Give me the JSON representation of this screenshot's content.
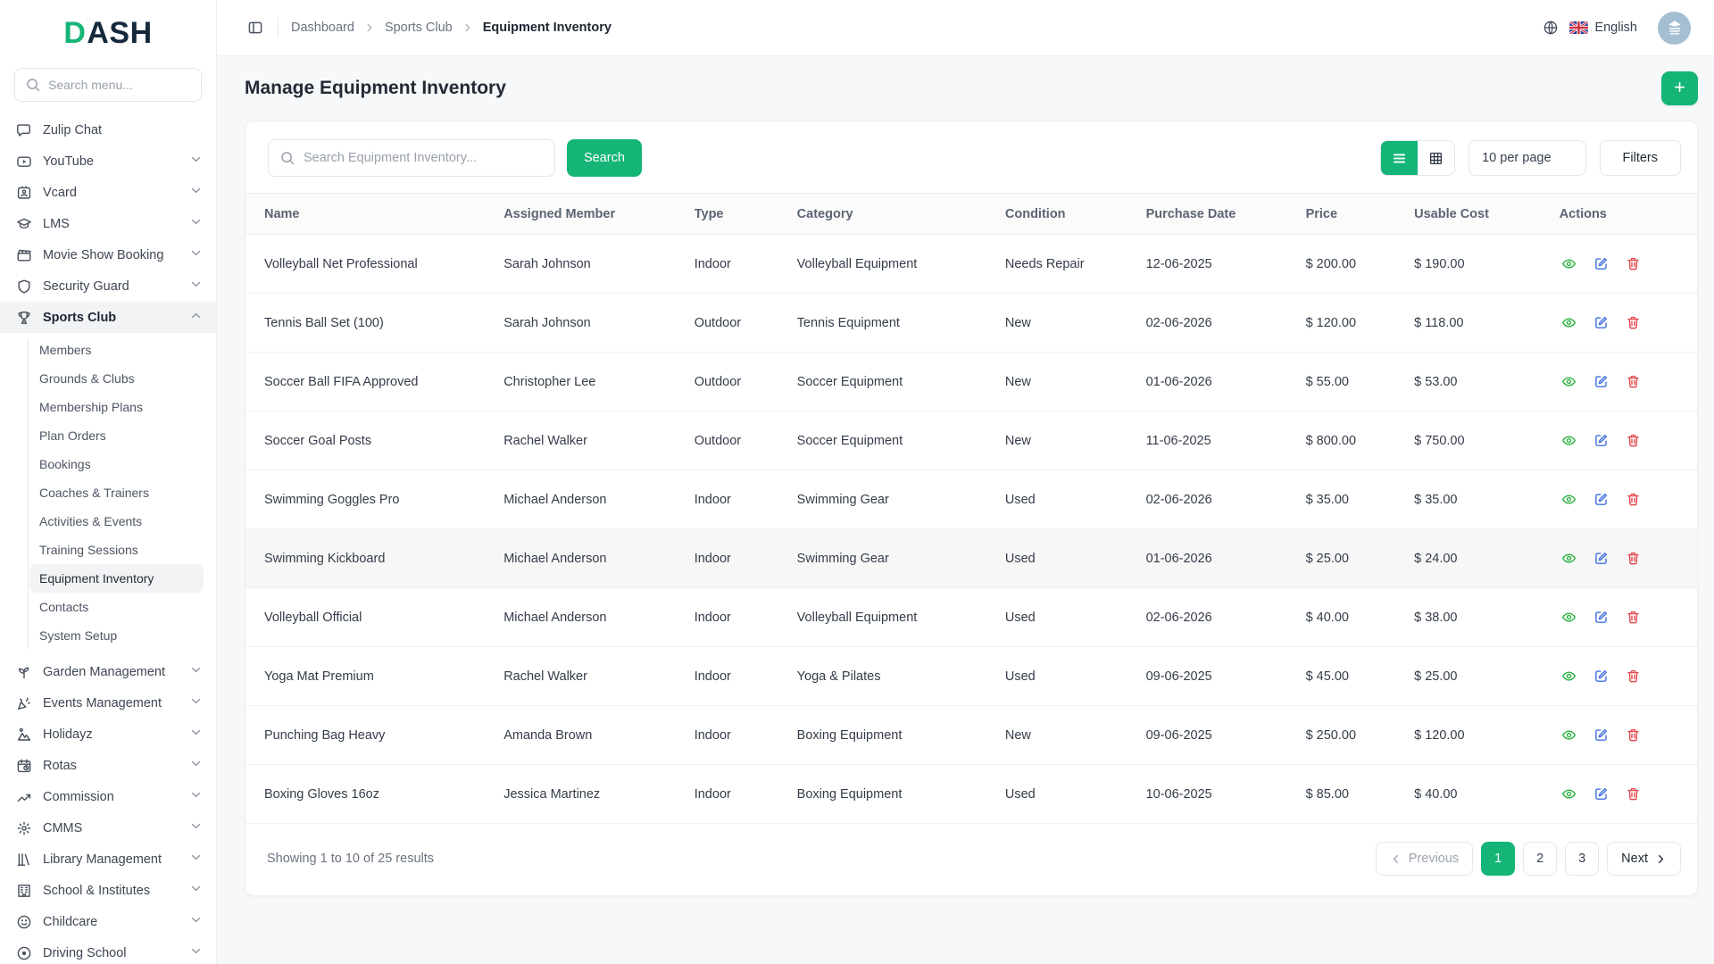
{
  "brand": {
    "logo_accent": "D",
    "logo_rest": "ASH"
  },
  "sidebar": {
    "search_placeholder": "Search menu...",
    "items": [
      {
        "label": "Zulip Chat",
        "icon": "chat-icon"
      },
      {
        "label": "YouTube",
        "icon": "youtube-icon",
        "chevron": "down"
      },
      {
        "label": "Vcard",
        "icon": "vcard-icon",
        "chevron": "down"
      },
      {
        "label": "LMS",
        "icon": "lms-icon",
        "chevron": "down"
      },
      {
        "label": "Movie Show Booking",
        "icon": "movie-icon",
        "chevron": "down"
      },
      {
        "label": "Security Guard",
        "icon": "shield-icon",
        "chevron": "down"
      },
      {
        "label": "Sports Club",
        "icon": "trophy-icon",
        "chevron": "up",
        "active": true,
        "children": [
          {
            "label": "Members"
          },
          {
            "label": "Grounds & Clubs"
          },
          {
            "label": "Membership Plans"
          },
          {
            "label": "Plan Orders"
          },
          {
            "label": "Bookings"
          },
          {
            "label": "Coaches & Trainers"
          },
          {
            "label": "Activities & Events"
          },
          {
            "label": "Training Sessions"
          },
          {
            "label": "Equipment Inventory",
            "active": true
          },
          {
            "label": "Contacts"
          },
          {
            "label": "System Setup"
          }
        ]
      },
      {
        "label": "Garden Management",
        "icon": "plant-icon",
        "chevron": "down"
      },
      {
        "label": "Events Management",
        "icon": "party-icon",
        "chevron": "down"
      },
      {
        "label": "Holidayz",
        "icon": "holiday-icon",
        "chevron": "down"
      },
      {
        "label": "Rotas",
        "icon": "calendar-clock-icon",
        "chevron": "down"
      },
      {
        "label": "Commission",
        "icon": "trend-icon",
        "chevron": "down"
      },
      {
        "label": "CMMS",
        "icon": "gear-icon",
        "chevron": "down"
      },
      {
        "label": "Library Management",
        "icon": "library-icon",
        "chevron": "down"
      },
      {
        "label": "School & Institutes",
        "icon": "school-icon",
        "chevron": "down"
      },
      {
        "label": "Childcare",
        "icon": "childcare-icon",
        "chevron": "down"
      },
      {
        "label": "Driving School",
        "icon": "driving-icon",
        "chevron": "down"
      }
    ]
  },
  "topbar": {
    "breadcrumbs": [
      "Dashboard",
      "Sports Club",
      "Equipment Inventory"
    ],
    "language": "English"
  },
  "page": {
    "title": "Manage Equipment Inventory",
    "add_button": "+"
  },
  "toolbar": {
    "search_placeholder": "Search Equipment Inventory...",
    "search_button": "Search",
    "per_page": "10 per page",
    "filters_label": "Filters"
  },
  "table": {
    "columns": [
      "Name",
      "Assigned Member",
      "Type",
      "Category",
      "Condition",
      "Purchase Date",
      "Price",
      "Usable Cost",
      "Actions"
    ],
    "rows": [
      {
        "name": "Volleyball Net Professional",
        "member": "Sarah Johnson",
        "type": "Indoor",
        "category": "Volleyball Equipment",
        "condition": "Needs Repair",
        "date": "12-06-2025",
        "price": "$ 200.00",
        "usable_cost": "$ 190.00"
      },
      {
        "name": "Tennis Ball Set (100)",
        "member": "Sarah Johnson",
        "type": "Outdoor",
        "category": "Tennis Equipment",
        "condition": "New",
        "date": "02-06-2026",
        "price": "$ 120.00",
        "usable_cost": "$ 118.00"
      },
      {
        "name": "Soccer Ball FIFA Approved",
        "member": "Christopher Lee",
        "type": "Outdoor",
        "category": "Soccer Equipment",
        "condition": "New",
        "date": "01-06-2026",
        "price": "$ 55.00",
        "usable_cost": "$ 53.00"
      },
      {
        "name": "Soccer Goal Posts",
        "member": "Rachel Walker",
        "type": "Outdoor",
        "category": "Soccer Equipment",
        "condition": "New",
        "date": "11-06-2025",
        "price": "$ 800.00",
        "usable_cost": "$ 750.00"
      },
      {
        "name": "Swimming Goggles Pro",
        "member": "Michael Anderson",
        "type": "Indoor",
        "category": "Swimming Gear",
        "condition": "Used",
        "date": "02-06-2026",
        "price": "$ 35.00",
        "usable_cost": "$ 35.00"
      },
      {
        "name": "Swimming Kickboard",
        "member": "Michael Anderson",
        "type": "Indoor",
        "category": "Swimming Gear",
        "condition": "Used",
        "date": "01-06-2026",
        "price": "$ 25.00",
        "usable_cost": "$ 24.00",
        "highlighted": true
      },
      {
        "name": "Volleyball Official",
        "member": "Michael Anderson",
        "type": "Indoor",
        "category": "Volleyball Equipment",
        "condition": "Used",
        "date": "02-06-2026",
        "price": "$ 40.00",
        "usable_cost": "$ 38.00"
      },
      {
        "name": "Yoga Mat Premium",
        "member": "Rachel Walker",
        "type": "Indoor",
        "category": "Yoga & Pilates",
        "condition": "Used",
        "date": "09-06-2025",
        "price": "$ 45.00",
        "usable_cost": "$ 25.00"
      },
      {
        "name": "Punching Bag Heavy",
        "member": "Amanda Brown",
        "type": "Indoor",
        "category": "Boxing Equipment",
        "condition": "New",
        "date": "09-06-2025",
        "price": "$ 250.00",
        "usable_cost": "$ 120.00"
      },
      {
        "name": "Boxing Gloves 16oz",
        "member": "Jessica Martinez",
        "type": "Indoor",
        "category": "Boxing Equipment",
        "condition": "Used",
        "date": "10-06-2025",
        "price": "$ 85.00",
        "usable_cost": "$ 40.00"
      }
    ],
    "row_actions": [
      "view",
      "edit",
      "delete"
    ]
  },
  "pagination": {
    "summary": "Showing 1 to 10 of 25 results",
    "previous_label": "Previous",
    "next_label": "Next",
    "pages": [
      "1",
      "2",
      "3"
    ],
    "active_page": "1"
  },
  "colors": {
    "accent": "#14b577",
    "view_icon": "#2fb344",
    "edit_icon": "#4070e0",
    "delete_icon": "#e5484d",
    "avatar_bg": "#a5bfd2"
  }
}
